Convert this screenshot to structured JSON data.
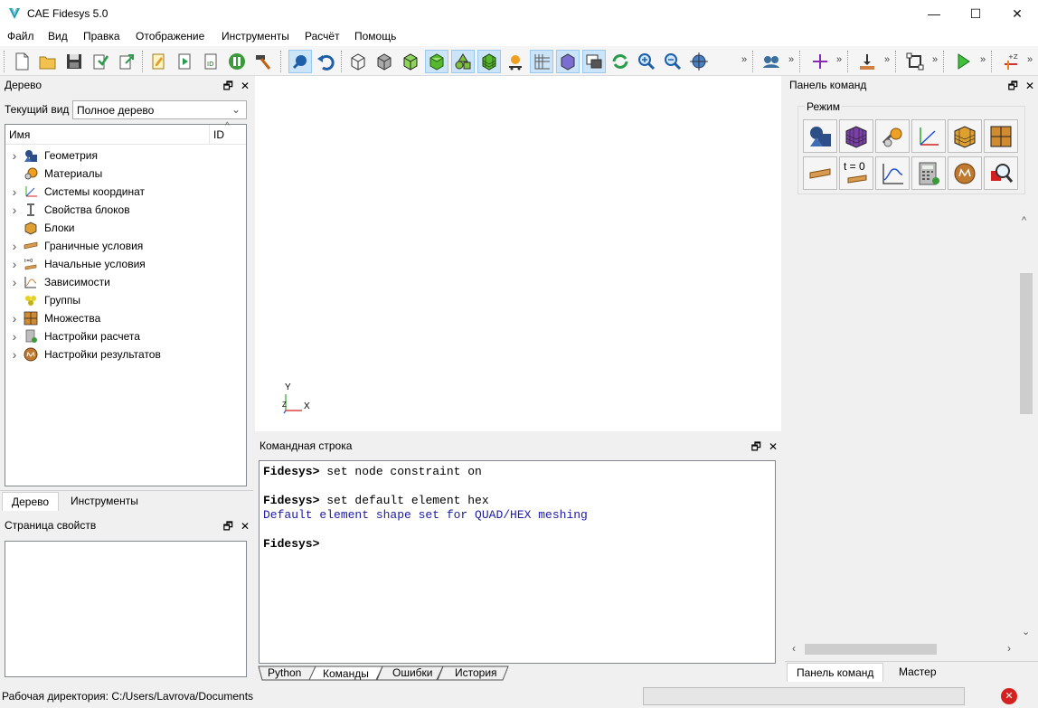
{
  "window": {
    "title": "CAE Fidesys 5.0",
    "minimize_icon": "minimize-icon",
    "maximize_icon": "maximize-icon",
    "close_icon": "close-icon",
    "minimize_glyph": "—",
    "maximize_glyph": "☐",
    "close_glyph": "✕"
  },
  "menu": [
    "Файл",
    "Вид",
    "Правка",
    "Отображение",
    "Инструменты",
    "Расчёт",
    "Помощь"
  ],
  "tree_panel": {
    "title": "Дерево",
    "view_label": "Текущий вид",
    "view_value": "Полное дерево",
    "col_name": "Имя",
    "col_id": "ID",
    "items": [
      {
        "label": "Геометрия",
        "icon": "geometry-icon",
        "expandable": true
      },
      {
        "label": "Материалы",
        "icon": "materials-icon",
        "expandable": false
      },
      {
        "label": "Системы координат",
        "icon": "coord-systems-icon",
        "expandable": true
      },
      {
        "label": "Свойства блоков",
        "icon": "block-properties-icon",
        "expandable": true
      },
      {
        "label": "Блоки",
        "icon": "blocks-icon",
        "expandable": false
      },
      {
        "label": "Граничные условия",
        "icon": "boundary-conditions-icon",
        "expandable": true
      },
      {
        "label": "Начальные условия",
        "icon": "initial-conditions-icon",
        "expandable": true
      },
      {
        "label": "Зависимости",
        "icon": "dependencies-icon",
        "expandable": true
      },
      {
        "label": "Группы",
        "icon": "groups-icon",
        "expandable": false
      },
      {
        "label": "Множества",
        "icon": "sets-icon",
        "expandable": true
      },
      {
        "label": "Настройки расчета",
        "icon": "calc-settings-icon",
        "expandable": true
      },
      {
        "label": "Настройки результатов",
        "icon": "result-settings-icon",
        "expandable": true
      }
    ],
    "tabs": [
      "Дерево",
      "Инструменты"
    ]
  },
  "properties_panel": {
    "title": "Страница свойств"
  },
  "viewport": {
    "axis_y": "Y",
    "axis_x": "X",
    "axis_z": "Z"
  },
  "command_line": {
    "title": "Командная строка",
    "prompt": "Fidesys>",
    "lines": [
      {
        "prompt": "Fidesys>",
        "text": " set node constraint on"
      },
      {
        "prompt": "Fidesys>",
        "text": " set default element hex"
      },
      {
        "info": "Default element shape set for QUAD/HEX meshing"
      },
      {
        "prompt": "Fidesys>",
        "text": ""
      }
    ],
    "tabs": [
      "Python",
      "Команды",
      "Ошибки",
      "История"
    ],
    "selected_tab": "Команды"
  },
  "command_panel": {
    "title": "Панель команд",
    "group_label": "Режим",
    "t0_label": "t = 0",
    "tabs": [
      "Панель команд",
      "Мастер"
    ]
  },
  "status": {
    "working_dir": "Рабочая директория: C:/Users/Lavrova/Documents"
  },
  "colors": {
    "info_text": "#1a1aa6",
    "accent": "#0078d7"
  }
}
